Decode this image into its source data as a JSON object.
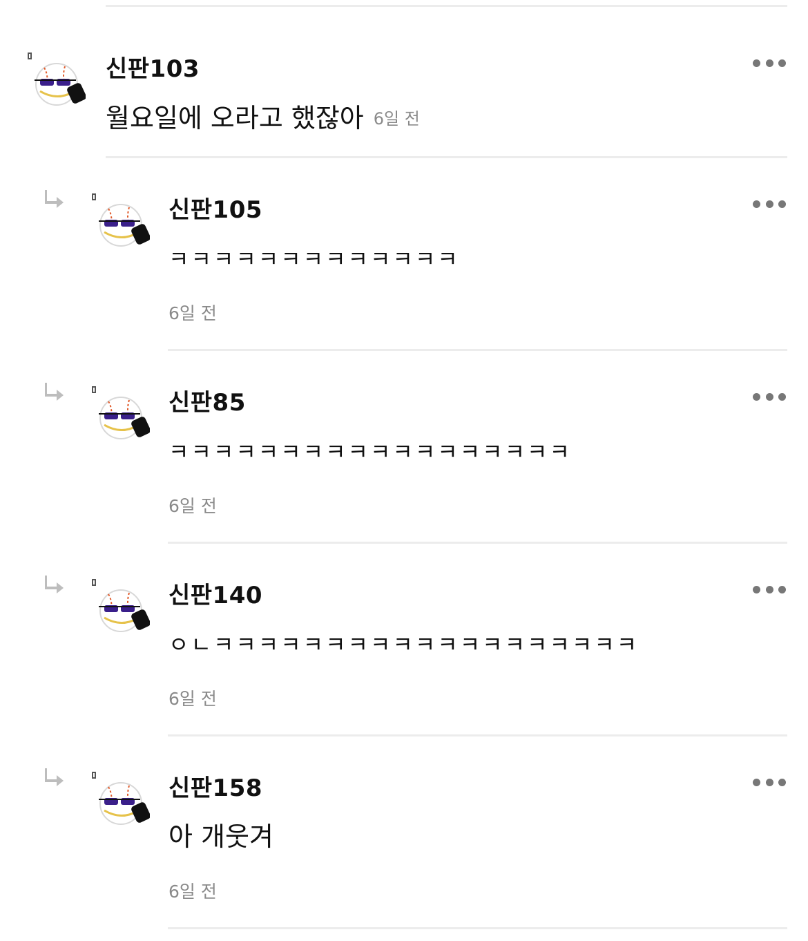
{
  "comments": [
    {
      "username": "신판103",
      "text": "월요일에 오라고 했잖아",
      "time": "6일 전"
    }
  ],
  "replies": [
    {
      "username": "신판105",
      "text": "ㅋㅋㅋㅋㅋㅋㅋㅋㅋㅋㅋㅋㅋ",
      "time": "6일 전"
    },
    {
      "username": "신판85",
      "text": "ㅋㅋㅋㅋㅋㅋㅋㅋㅋㅋㅋㅋㅋㅋㅋㅋㅋㅋ",
      "time": "6일 전"
    },
    {
      "username": "신판140",
      "text": "ㅇㄴㅋㅋㅋㅋㅋㅋㅋㅋㅋㅋㅋㅋㅋㅋㅋㅋㅋㅋㅋ",
      "time": "6일 전"
    },
    {
      "username": "신판158",
      "text": "아 개웃겨",
      "time": "6일 전"
    }
  ],
  "icons": {
    "more": "more-options-icon",
    "reply": "reply-arrow-icon",
    "avatar": "baseball-sunglasses-avatar"
  },
  "colors": {
    "divider": "#ececec",
    "time": "#8a8a8a",
    "username": "#111111",
    "dots": "#777777"
  }
}
